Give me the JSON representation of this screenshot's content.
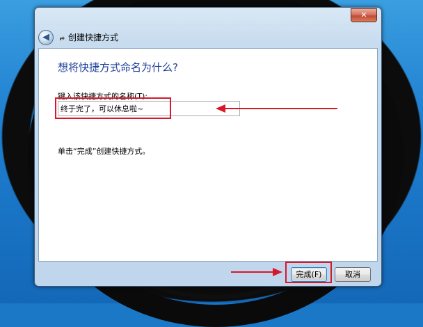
{
  "window": {
    "title": "创建快捷方式",
    "close_glyph": "✕",
    "back_glyph": "◀",
    "title_icon": "shortcut-icon"
  },
  "content": {
    "heading": "想将快捷方式命名为什么?",
    "field_label": "键入该快捷方式的名称(T):",
    "name_value": "终于完了，可以休息啦~",
    "hint": "单击“完成”创建快捷方式。"
  },
  "footer": {
    "finish_label": "完成(F)",
    "cancel_label": "取消"
  },
  "colors": {
    "annotation": "#d7182a",
    "heading": "#1e3f9a"
  }
}
